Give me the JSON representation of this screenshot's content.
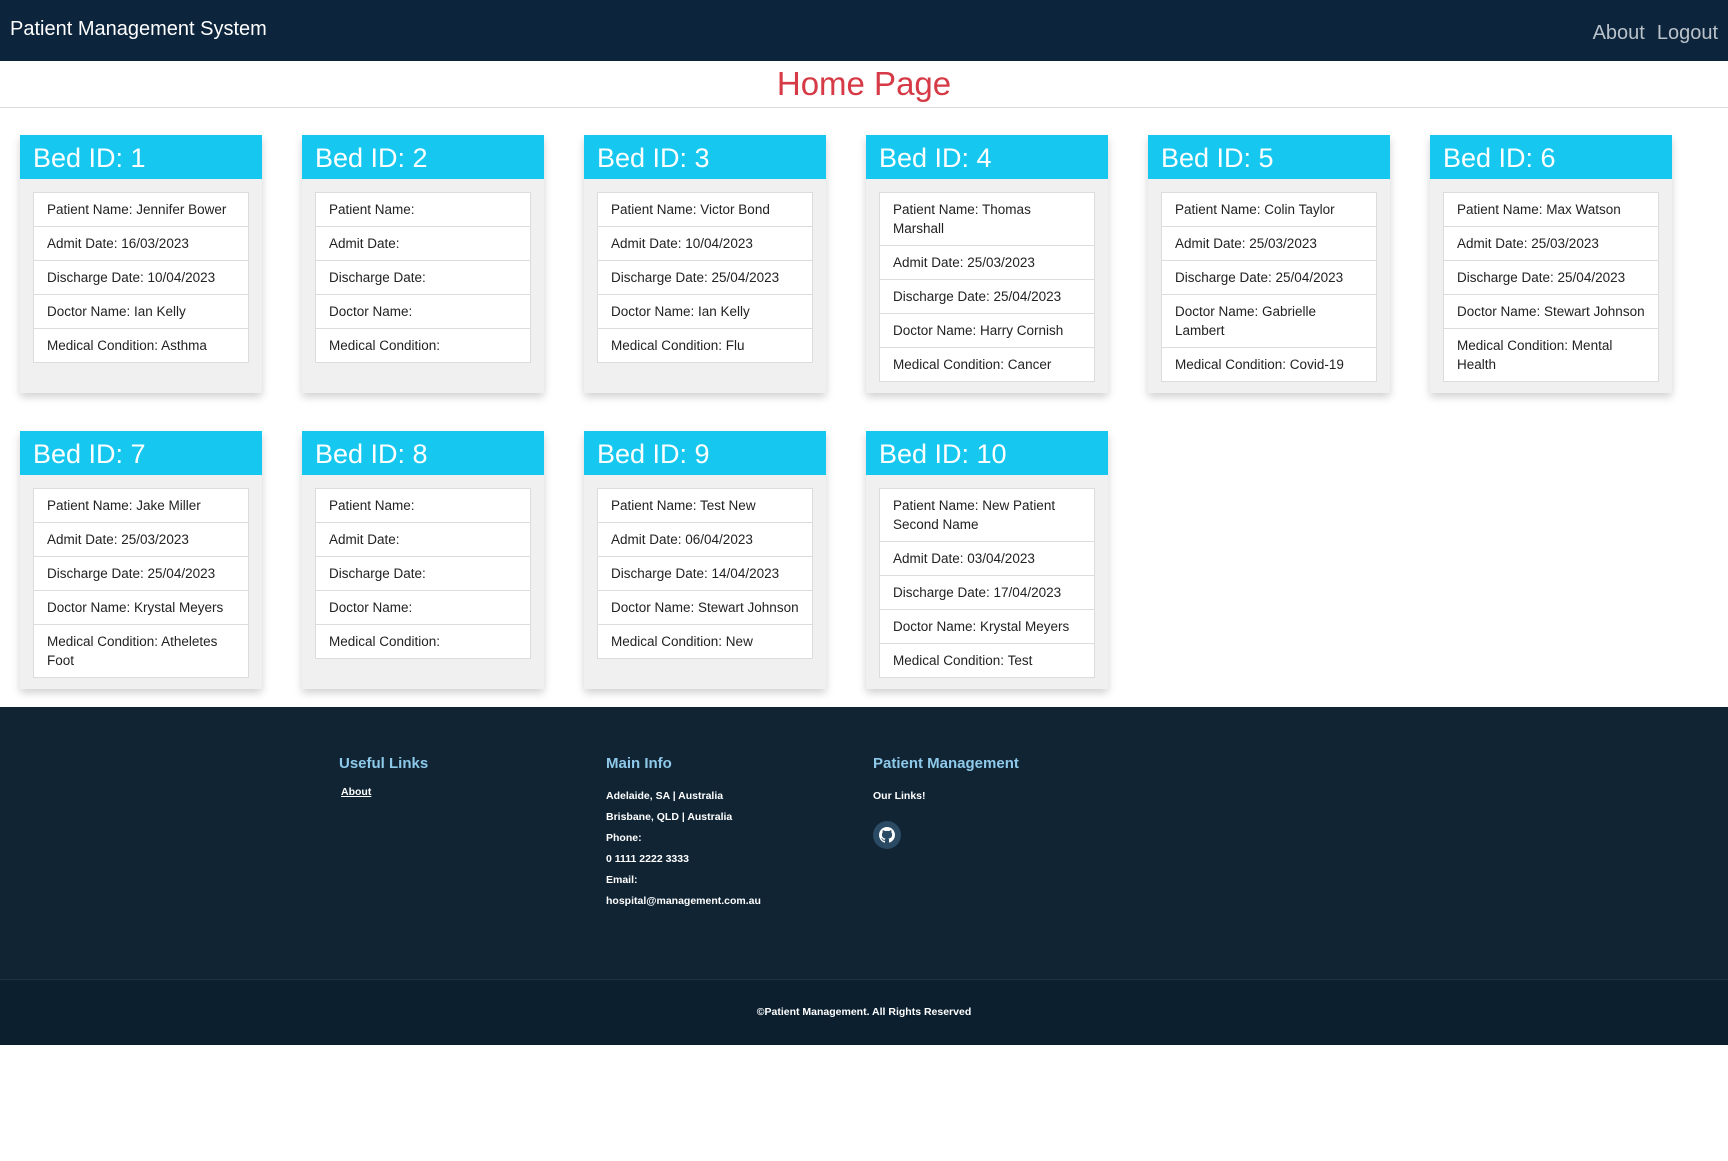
{
  "navbar": {
    "brand": "Patient Management System",
    "links": [
      "About",
      "Logout"
    ]
  },
  "page": {
    "title": "Home Page"
  },
  "beds": [
    {
      "header": "Bed ID: 1",
      "fields": [
        "Patient Name: Jennifer Bower",
        "Admit Date: 16/03/2023",
        "Discharge Date: 10/04/2023",
        "Doctor Name: Ian Kelly",
        "Medical Condition: Asthma"
      ]
    },
    {
      "header": "Bed ID: 2",
      "fields": [
        "Patient Name:",
        "Admit Date:",
        "Discharge Date:",
        "Doctor Name:",
        "Medical Condition:"
      ]
    },
    {
      "header": "Bed ID: 3",
      "fields": [
        "Patient Name: Victor Bond",
        "Admit Date: 10/04/2023",
        "Discharge Date: 25/04/2023",
        "Doctor Name: Ian Kelly",
        "Medical Condition: Flu"
      ]
    },
    {
      "header": "Bed ID: 4",
      "fields": [
        "Patient Name: Thomas Marshall",
        "Admit Date: 25/03/2023",
        "Discharge Date: 25/04/2023",
        "Doctor Name: Harry Cornish",
        "Medical Condition: Cancer"
      ]
    },
    {
      "header": "Bed ID: 5",
      "fields": [
        "Patient Name: Colin Taylor",
        "Admit Date: 25/03/2023",
        "Discharge Date: 25/04/2023",
        "Doctor Name: Gabrielle Lambert",
        "Medical Condition: Covid-19"
      ]
    },
    {
      "header": "Bed ID: 6",
      "fields": [
        "Patient Name: Max Watson",
        "Admit Date: 25/03/2023",
        "Discharge Date: 25/04/2023",
        "Doctor Name: Stewart Johnson",
        "Medical Condition: Mental Health"
      ]
    },
    {
      "header": "Bed ID: 7",
      "fields": [
        "Patient Name: Jake Miller",
        "Admit Date: 25/03/2023",
        "Discharge Date: 25/04/2023",
        "Doctor Name: Krystal Meyers",
        "Medical Condition: Atheletes Foot"
      ]
    },
    {
      "header": "Bed ID: 8",
      "fields": [
        "Patient Name:",
        "Admit Date:",
        "Discharge Date:",
        "Doctor Name:",
        "Medical Condition:"
      ]
    },
    {
      "header": "Bed ID: 9",
      "fields": [
        "Patient Name: Test New",
        "Admit Date: 06/04/2023",
        "Discharge Date: 14/04/2023",
        "Doctor Name: Stewart Johnson",
        "Medical Condition: New"
      ]
    },
    {
      "header": "Bed ID: 10",
      "fields": [
        "Patient Name: New Patient Second Name",
        "Admit Date: 03/04/2023",
        "Discharge Date: 17/04/2023",
        "Doctor Name: Krystal Meyers",
        "Medical Condition: Test"
      ]
    }
  ],
  "footer": {
    "useful_links": {
      "heading": "Useful Links",
      "links": [
        "About"
      ]
    },
    "main_info": {
      "heading": "Main Info",
      "lines": [
        "Adelaide, SA | Australia",
        "Brisbane, QLD | Australia",
        "Phone:",
        "0 1111 2222 3333",
        "Email:",
        "hospital@management.com.au"
      ]
    },
    "patient_management": {
      "heading": "Patient Management",
      "subtitle": "Our Links!",
      "icon": "github-icon"
    },
    "copyright": "©Patient Management. All Rights Reserved"
  },
  "colors": {
    "navbar": "#0c243c",
    "title": "#d63a46",
    "bed_header": "#16c8ef",
    "footer": "#102434",
    "footer_heading": "#8ec9ea"
  }
}
